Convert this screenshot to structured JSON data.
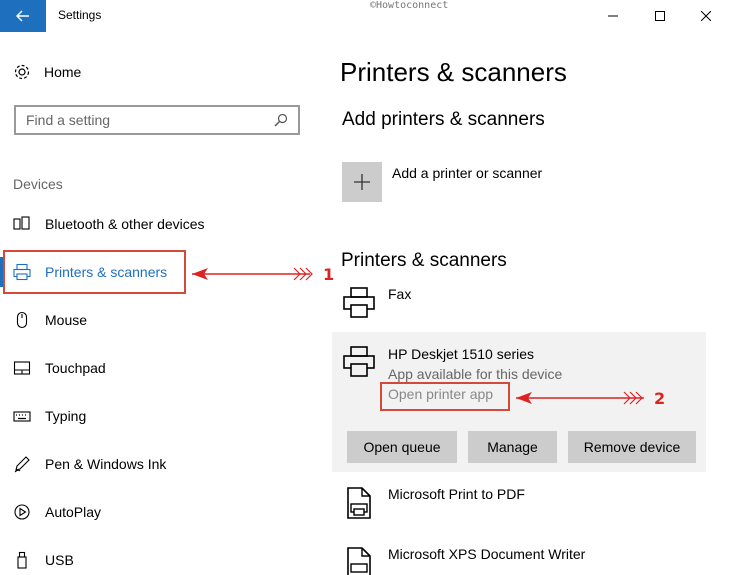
{
  "window": {
    "title": "Settings",
    "watermark": "©Howtoconnect"
  },
  "sidebar": {
    "home_label": "Home",
    "search_placeholder": "Find a setting",
    "section_label": "Devices",
    "items": [
      {
        "label": "Bluetooth & other devices",
        "icon": "bluetooth-icon"
      },
      {
        "label": "Printers & scanners",
        "icon": "printer-icon",
        "selected": true
      },
      {
        "label": "Mouse",
        "icon": "mouse-icon"
      },
      {
        "label": "Touchpad",
        "icon": "touchpad-icon"
      },
      {
        "label": "Typing",
        "icon": "keyboard-icon"
      },
      {
        "label": "Pen & Windows Ink",
        "icon": "pen-icon"
      },
      {
        "label": "AutoPlay",
        "icon": "autoplay-icon"
      },
      {
        "label": "USB",
        "icon": "usb-icon"
      }
    ]
  },
  "main": {
    "title": "Printers & scanners",
    "add_section_title": "Add printers & scanners",
    "add_label": "Add a printer or scanner",
    "list_section_title": "Printers & scanners",
    "printers": [
      {
        "name": "Fax"
      },
      {
        "name": "HP Deskjet 1510 series",
        "status": "App available for this device",
        "link": "Open printer app",
        "actions": [
          "Open queue",
          "Manage",
          "Remove device"
        ]
      },
      {
        "name": "Microsoft Print to PDF"
      },
      {
        "name": "Microsoft XPS Document Writer"
      }
    ]
  },
  "annotations": {
    "one": "1",
    "two": "2"
  },
  "colors": {
    "accent": "#1f6fbf",
    "annotation": "#d24a3a"
  }
}
